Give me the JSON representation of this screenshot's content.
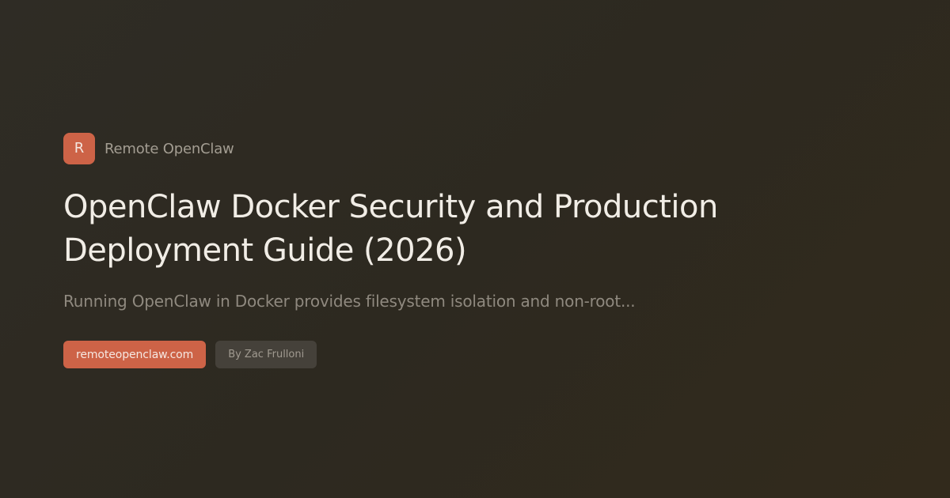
{
  "brand": {
    "logo_letter": "R",
    "name": "Remote OpenClaw",
    "accent_color": "#cd6347"
  },
  "article": {
    "title": "OpenClaw Docker Security and Production Deployment Guide (2026)",
    "excerpt": "Running OpenClaw in Docker provides filesystem isolation and non-root..."
  },
  "tags": {
    "domain": "remoteopenclaw.com",
    "author": "By Zac Frulloni"
  }
}
